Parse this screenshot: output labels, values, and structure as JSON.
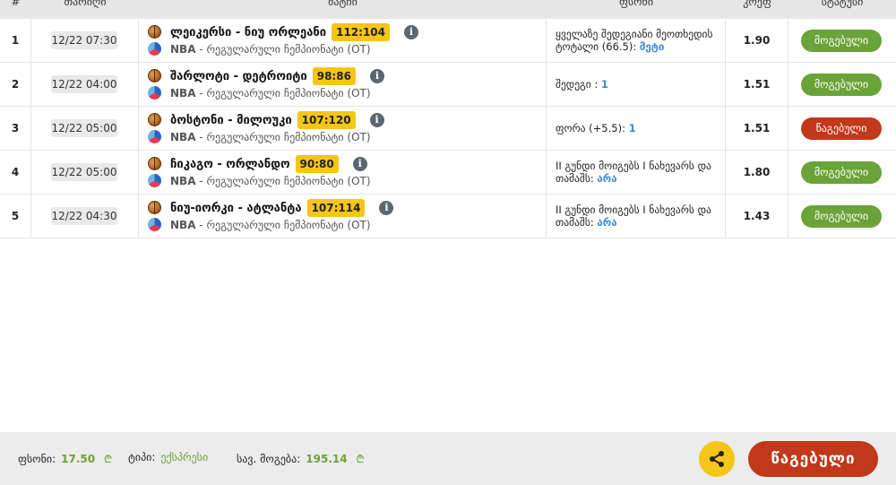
{
  "header": {
    "num": "#",
    "time": "თარიღი",
    "match": "მატჩი",
    "bet": "ფსონი",
    "odd": "კოეფ",
    "status": "სტატუსი"
  },
  "rows": [
    {
      "num": "1",
      "time": "12/22 07:30",
      "teams": "ლეიკერსი - ნიუ ორლეანი",
      "score": "112:104",
      "league_name": "NBA",
      "league_desc": " - რეგულარული ჩემპიონატი (OT)",
      "bet_text": "ყველაზე შედეგიანი მეოთხედის ტოტალი (66.5): ",
      "bet_pick": "მეტი",
      "odd": "1.90",
      "status": "მოგებული",
      "status_type": "win"
    },
    {
      "num": "2",
      "time": "12/22 04:00",
      "teams": "შარლოტი - დეტროიტი",
      "score": "98:86",
      "league_name": "NBA",
      "league_desc": " - რეგულარული ჩემპიონატი (OT)",
      "bet_text": "შედეგი : ",
      "bet_pick": "1",
      "odd": "1.51",
      "status": "მოგებული",
      "status_type": "win"
    },
    {
      "num": "3",
      "time": "12/22 05:00",
      "teams": "ბოსტონი - მილოუკი",
      "score": "107:120",
      "league_name": "NBA",
      "league_desc": " - რეგულარული ჩემპიონატი (OT)",
      "bet_text": "ფორა (+5.5): ",
      "bet_pick": "1",
      "odd": "1.51",
      "status": "წაგებული",
      "status_type": "lose"
    },
    {
      "num": "4",
      "time": "12/22 05:00",
      "teams": "ჩიკაგო - ორლანდო",
      "score": "90:80",
      "league_name": "NBA",
      "league_desc": " - რეგულარული ჩემპიონატი (OT)",
      "bet_text": "II გუნდი მოიგებს I ნახევარს და თამაშს: ",
      "bet_pick": "არა",
      "odd": "1.80",
      "status": "მოგებული",
      "status_type": "win"
    },
    {
      "num": "5",
      "time": "12/22 04:30",
      "teams": "ნიუ-იორკი - ატლანტა",
      "score": "107:114",
      "league_name": "NBA",
      "league_desc": " - რეგულარული ჩემპიონატი (OT)",
      "bet_text": "II გუნდი მოიგებს I ნახევარს და თამაშს: ",
      "bet_pick": "არა",
      "odd": "1.43",
      "status": "მოგებული",
      "status_type": "win"
    }
  ],
  "icons": {
    "sport": "basketball-icon",
    "league": "nba-league-icon",
    "info": "info-icon",
    "share": "share-icon",
    "currency": "lari-icon"
  },
  "footer": {
    "stake_label": "ფსონი:",
    "stake_value": "17.50",
    "type_label": "ტიპი:",
    "type_value": "ექსპრესი",
    "win_label": "სავ. მოგება:",
    "win_value": "195.14",
    "currency_symbol": "₾",
    "status_label": "წაგებული"
  },
  "colors": {
    "win": "#6aa338",
    "lose": "#c1381a",
    "score_bg": "#f5c518",
    "accent": "#3a8bd6"
  }
}
